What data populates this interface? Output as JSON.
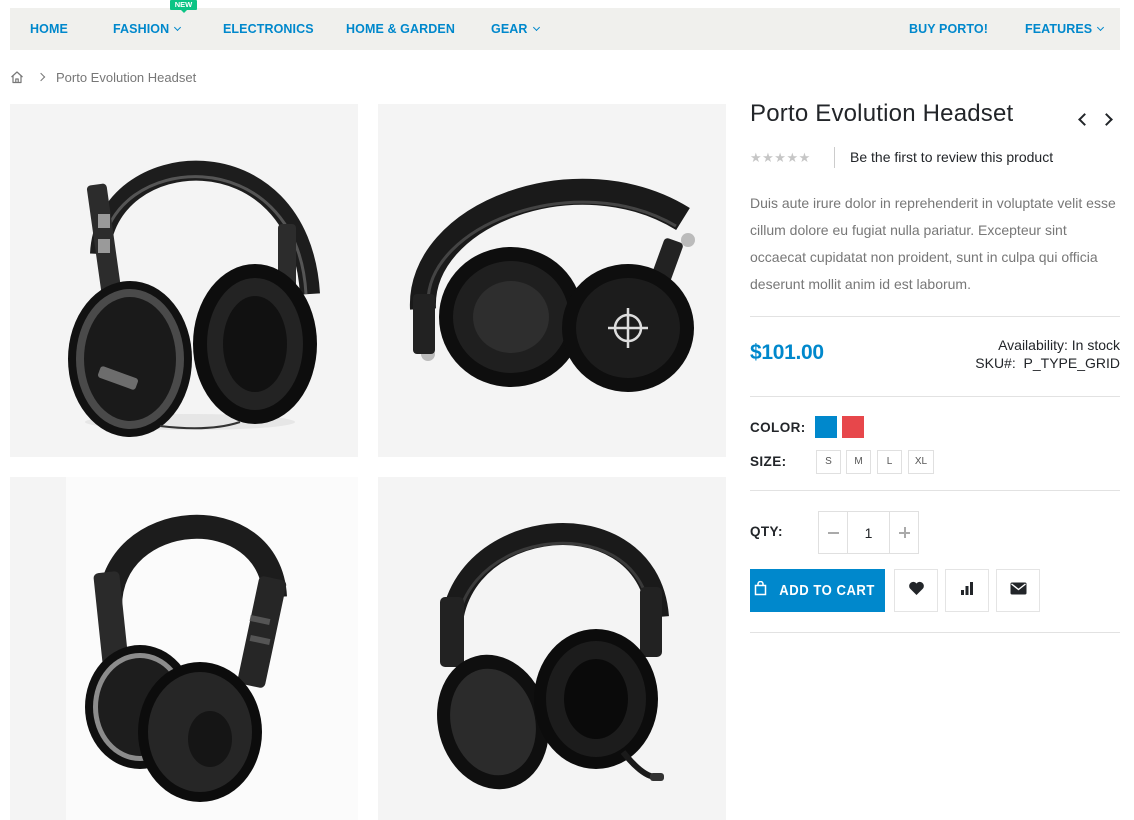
{
  "nav": {
    "items": [
      {
        "label": "HOME"
      },
      {
        "label": "FASHION",
        "badge": "NEW"
      },
      {
        "label": "ELECTRONICS"
      },
      {
        "label": "HOME & GARDEN"
      },
      {
        "label": "GEAR"
      },
      {
        "label": "BUY PORTO!"
      },
      {
        "label": "FEATURES"
      }
    ],
    "accent_color": "#0088cc",
    "badge_color": "#0cc485"
  },
  "breadcrumb": {
    "home_icon": "home-icon",
    "current": "Porto Evolution Headset"
  },
  "gallery": {
    "images": [
      "headset-image-1",
      "headset-image-2",
      "headset-image-3",
      "headset-image-4"
    ]
  },
  "product": {
    "title": "Porto Evolution Headset",
    "rating_stars": "★★★★★",
    "rating_value": 0,
    "review_link": "Be the first to review this product",
    "description": "Duis aute irure dolor in reprehenderit in voluptate velit esse cillum dolore eu fugiat nulla pariatur. Excepteur sint occaecat cupidatat non proident, sunt in culpa qui officia deserunt mollit anim id est laborum.",
    "price": "$101.00",
    "availability_label": "Availability:",
    "availability_value": "In stock",
    "sku_label": "SKU#:",
    "sku_value": "P_TYPE_GRID",
    "color_label": "COLOR:",
    "colors": [
      "#0088cc",
      "#e7474b"
    ],
    "size_label": "SIZE:",
    "sizes": [
      "S",
      "M",
      "L",
      "XL"
    ],
    "qty_label": "QTY:",
    "qty_value": "1",
    "add_to_cart": "ADD TO CART",
    "action_icons": [
      "heart-icon",
      "chart-icon",
      "envelope-icon"
    ]
  }
}
